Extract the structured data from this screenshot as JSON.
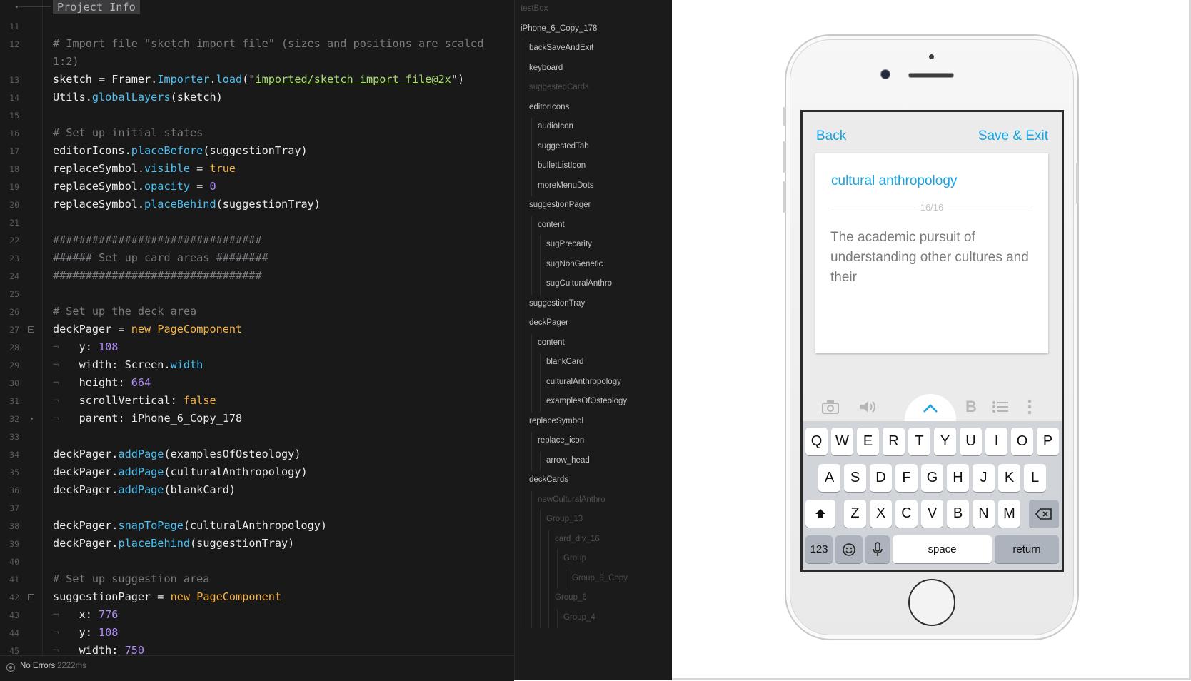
{
  "editor": {
    "tab_title": "Project Info",
    "lines": [
      {
        "n": "11",
        "tokens": []
      },
      {
        "n": "12",
        "tokens": [
          {
            "t": "# Import file \"sketch import file\" (sizes and positions are scaled",
            "c": "c"
          }
        ]
      },
      {
        "n": "",
        "tokens": [
          {
            "t": "1:2)",
            "c": "c"
          }
        ]
      },
      {
        "n": "13",
        "tokens": [
          {
            "t": "sketch = Framer.",
            "c": "w"
          },
          {
            "t": "Importer",
            "c": "m"
          },
          {
            "t": ".",
            "c": "w"
          },
          {
            "t": "load",
            "c": "m"
          },
          {
            "t": "(\"",
            "c": "w"
          },
          {
            "t": "imported/sketch import file@2x",
            "c": "s"
          },
          {
            "t": "\")",
            "c": "w"
          }
        ]
      },
      {
        "n": "14",
        "tokens": [
          {
            "t": "Utils.",
            "c": "w"
          },
          {
            "t": "globalLayers",
            "c": "m"
          },
          {
            "t": "(sketch)",
            "c": "w"
          }
        ]
      },
      {
        "n": "15",
        "tokens": []
      },
      {
        "n": "16",
        "tokens": [
          {
            "t": "# Set up initial states",
            "c": "c"
          }
        ]
      },
      {
        "n": "17",
        "tokens": [
          {
            "t": "editorIcons.",
            "c": "w"
          },
          {
            "t": "placeBefore",
            "c": "m"
          },
          {
            "t": "(suggestionTray)",
            "c": "w"
          }
        ]
      },
      {
        "n": "18",
        "tokens": [
          {
            "t": "replaceSymbol.",
            "c": "w"
          },
          {
            "t": "visible",
            "c": "m"
          },
          {
            "t": " = ",
            "c": "w"
          },
          {
            "t": "true",
            "c": "k"
          }
        ]
      },
      {
        "n": "19",
        "tokens": [
          {
            "t": "replaceSymbol.",
            "c": "w"
          },
          {
            "t": "opacity",
            "c": "m"
          },
          {
            "t": " = ",
            "c": "w"
          },
          {
            "t": "0",
            "c": "n"
          }
        ]
      },
      {
        "n": "20",
        "tokens": [
          {
            "t": "replaceSymbol.",
            "c": "w"
          },
          {
            "t": "placeBehind",
            "c": "m"
          },
          {
            "t": "(suggestionTray)",
            "c": "w"
          }
        ]
      },
      {
        "n": "21",
        "tokens": []
      },
      {
        "n": "22",
        "tokens": [
          {
            "t": "################################",
            "c": "c"
          }
        ]
      },
      {
        "n": "23",
        "tokens": [
          {
            "t": "###### Set up card areas ########",
            "c": "c"
          }
        ]
      },
      {
        "n": "24",
        "tokens": [
          {
            "t": "################################",
            "c": "c"
          }
        ]
      },
      {
        "n": "25",
        "tokens": []
      },
      {
        "n": "26",
        "tokens": [
          {
            "t": "# Set up the deck area",
            "c": "c"
          }
        ]
      },
      {
        "n": "27",
        "fold": "box",
        "tokens": [
          {
            "t": "deckPager = ",
            "c": "w"
          },
          {
            "t": "new",
            "c": "k"
          },
          {
            "t": " ",
            "c": "w"
          },
          {
            "t": "PageComponent",
            "c": "k"
          }
        ]
      },
      {
        "n": "28",
        "tokens": [
          {
            "t": "¬   ",
            "c": "tab"
          },
          {
            "t": "y: ",
            "c": "w"
          },
          {
            "t": "108",
            "c": "n"
          }
        ]
      },
      {
        "n": "29",
        "tokens": [
          {
            "t": "¬   ",
            "c": "tab"
          },
          {
            "t": "width: Screen.",
            "c": "w"
          },
          {
            "t": "width",
            "c": "m"
          }
        ]
      },
      {
        "n": "30",
        "tokens": [
          {
            "t": "¬   ",
            "c": "tab"
          },
          {
            "t": "height: ",
            "c": "w"
          },
          {
            "t": "664",
            "c": "n"
          }
        ]
      },
      {
        "n": "31",
        "tokens": [
          {
            "t": "¬   ",
            "c": "tab"
          },
          {
            "t": "scrollVertical: ",
            "c": "w"
          },
          {
            "t": "false",
            "c": "k"
          }
        ]
      },
      {
        "n": "32",
        "fold": "dot",
        "tokens": [
          {
            "t": "¬   ",
            "c": "tab"
          },
          {
            "t": "parent: iPhone_6_Copy_178",
            "c": "w"
          }
        ]
      },
      {
        "n": "33",
        "tokens": []
      },
      {
        "n": "34",
        "tokens": [
          {
            "t": "deckPager.",
            "c": "w"
          },
          {
            "t": "addPage",
            "c": "m"
          },
          {
            "t": "(examplesOfOsteology)",
            "c": "w"
          }
        ]
      },
      {
        "n": "35",
        "tokens": [
          {
            "t": "deckPager.",
            "c": "w"
          },
          {
            "t": "addPage",
            "c": "m"
          },
          {
            "t": "(culturalAnthropology)",
            "c": "w"
          }
        ]
      },
      {
        "n": "36",
        "tokens": [
          {
            "t": "deckPager.",
            "c": "w"
          },
          {
            "t": "addPage",
            "c": "m"
          },
          {
            "t": "(blankCard)",
            "c": "w"
          }
        ]
      },
      {
        "n": "37",
        "tokens": []
      },
      {
        "n": "38",
        "tokens": [
          {
            "t": "deckPager.",
            "c": "w"
          },
          {
            "t": "snapToPage",
            "c": "m"
          },
          {
            "t": "(culturalAnthropology)",
            "c": "w"
          }
        ]
      },
      {
        "n": "39",
        "tokens": [
          {
            "t": "deckPager.",
            "c": "w"
          },
          {
            "t": "placeBehind",
            "c": "m"
          },
          {
            "t": "(suggestionTray)",
            "c": "w"
          }
        ]
      },
      {
        "n": "40",
        "tokens": []
      },
      {
        "n": "41",
        "tokens": [
          {
            "t": "# Set up suggestion area",
            "c": "c"
          }
        ]
      },
      {
        "n": "42",
        "fold": "box",
        "tokens": [
          {
            "t": "suggestionPager = ",
            "c": "w"
          },
          {
            "t": "new",
            "c": "k"
          },
          {
            "t": " ",
            "c": "w"
          },
          {
            "t": "PageComponent",
            "c": "k"
          }
        ]
      },
      {
        "n": "43",
        "tokens": [
          {
            "t": "¬   ",
            "c": "tab"
          },
          {
            "t": "x: ",
            "c": "w"
          },
          {
            "t": "776",
            "c": "n"
          }
        ]
      },
      {
        "n": "44",
        "tokens": [
          {
            "t": "¬   ",
            "c": "tab"
          },
          {
            "t": "y: ",
            "c": "w"
          },
          {
            "t": "108",
            "c": "n"
          }
        ]
      },
      {
        "n": "45",
        "tokens": [
          {
            "t": "¬   ",
            "c": "tab"
          },
          {
            "t": "width: ",
            "c": "w"
          },
          {
            "t": "750",
            "c": "n"
          }
        ]
      }
    ]
  },
  "status": {
    "text": "No Errors",
    "time": "2222ms"
  },
  "layers": [
    {
      "name": "testBox",
      "depth": 0,
      "dim": true
    },
    {
      "name": "iPhone_6_Copy_178",
      "depth": 0,
      "dim": false
    },
    {
      "name": "backSaveAndExit",
      "depth": 1,
      "dim": false
    },
    {
      "name": "keyboard",
      "depth": 1,
      "dim": false
    },
    {
      "name": "suggestedCards",
      "depth": 1,
      "dim": true
    },
    {
      "name": "editorIcons",
      "depth": 1,
      "dim": false
    },
    {
      "name": "audioIcon",
      "depth": 2,
      "dim": false
    },
    {
      "name": "suggestedTab",
      "depth": 2,
      "dim": false
    },
    {
      "name": "bulletListIcon",
      "depth": 2,
      "dim": false
    },
    {
      "name": "moreMenuDots",
      "depth": 2,
      "dim": false
    },
    {
      "name": "suggestionPager",
      "depth": 1,
      "dim": false
    },
    {
      "name": "content",
      "depth": 2,
      "dim": false
    },
    {
      "name": "sugPrecarity",
      "depth": 3,
      "dim": false
    },
    {
      "name": "sugNonGenetic",
      "depth": 3,
      "dim": false
    },
    {
      "name": "sugCulturalAnthro",
      "depth": 3,
      "dim": false
    },
    {
      "name": "suggestionTray",
      "depth": 1,
      "dim": false
    },
    {
      "name": "deckPager",
      "depth": 1,
      "dim": false
    },
    {
      "name": "content",
      "depth": 2,
      "dim": false
    },
    {
      "name": "blankCard",
      "depth": 3,
      "dim": false
    },
    {
      "name": "culturalAnthropology",
      "depth": 3,
      "dim": false
    },
    {
      "name": "examplesOfOsteology",
      "depth": 3,
      "dim": false
    },
    {
      "name": "replaceSymbol",
      "depth": 1,
      "dim": false
    },
    {
      "name": "replace_icon",
      "depth": 2,
      "dim": false
    },
    {
      "name": "arrow_head",
      "depth": 3,
      "dim": false
    },
    {
      "name": "deckCards",
      "depth": 1,
      "dim": false
    },
    {
      "name": "newCulturalAnthro",
      "depth": 2,
      "dim": true
    },
    {
      "name": "Group_13",
      "depth": 3,
      "dim": true
    },
    {
      "name": "card_div_16",
      "depth": 4,
      "dim": true
    },
    {
      "name": "Group",
      "depth": 5,
      "dim": true
    },
    {
      "name": "Group_8_Copy",
      "depth": 6,
      "dim": true
    },
    {
      "name": "Group_6",
      "depth": 4,
      "dim": true
    },
    {
      "name": "Group_4",
      "depth": 5,
      "dim": true
    }
  ],
  "phone": {
    "nav_back": "Back",
    "nav_save": "Save & Exit",
    "card_title": "cultural anthropology",
    "card_count": "16/16",
    "card_body": "The academic pursuit of understanding other cultures and their",
    "toolbar_icons": [
      "camera-icon",
      "audio-icon",
      "bold-icon",
      "bullet-list-icon",
      "more-dots-icon"
    ],
    "keys_row1": [
      "Q",
      "W",
      "E",
      "R",
      "T",
      "Y",
      "U",
      "I",
      "O",
      "P"
    ],
    "keys_row2": [
      "A",
      "S",
      "D",
      "F",
      "G",
      "H",
      "J",
      "K",
      "L"
    ],
    "keys_row3": [
      "Z",
      "X",
      "C",
      "V",
      "B",
      "N",
      "M"
    ],
    "key_123": "123",
    "key_space": "space",
    "key_return": "return"
  },
  "colors": {
    "accent": "#17a4e0",
    "editor_bg": "#19191a",
    "keyword": "#f7b442",
    "method": "#4cc1f2",
    "number": "#b08cf6",
    "string": "#a9dd6d",
    "comment": "#7b7b7f"
  }
}
